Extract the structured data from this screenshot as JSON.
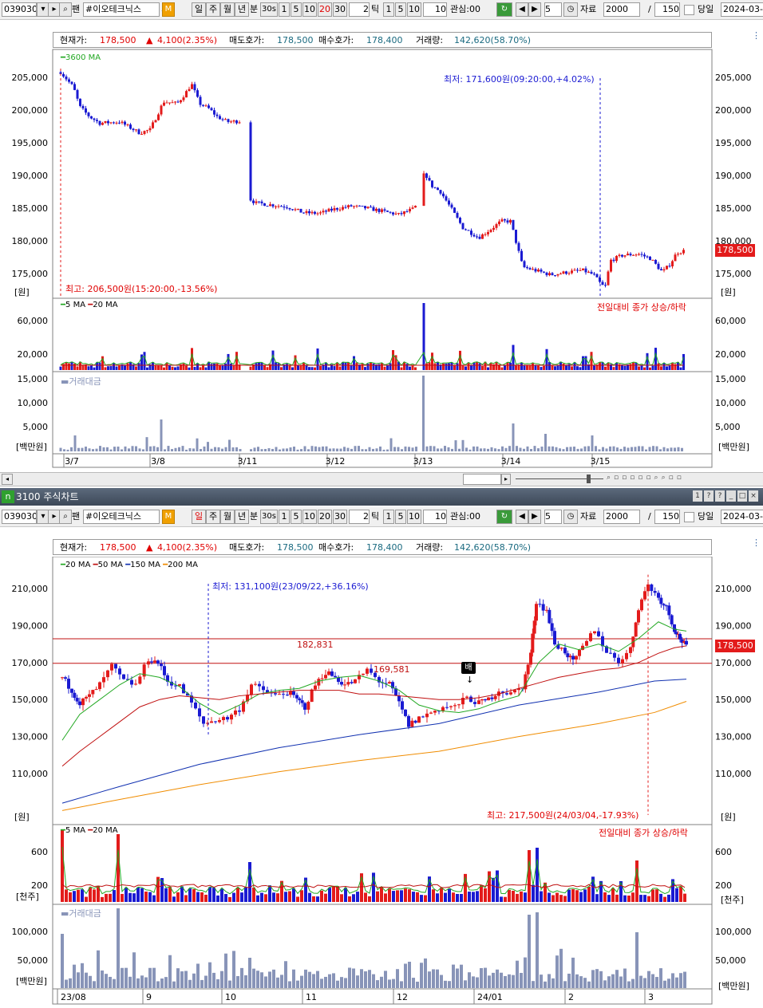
{
  "toolbar": {
    "code": "039030",
    "name": "#이오테크닉스",
    "periods": [
      "일",
      "주",
      "월",
      "년",
      "분"
    ],
    "sec": "30s",
    "mins": [
      "1",
      "5",
      "10",
      "20",
      "30"
    ],
    "tick_value": "2",
    "tick_label": "틱",
    "ticks": [
      "1",
      "5",
      "10"
    ],
    "ticks_val": "10",
    "watch": "관심:00",
    "step": "5",
    "data_label": "자료",
    "data_count": "2000",
    "slash": "/",
    "view_count": "150",
    "today_label": "당일",
    "date": "2024-03-"
  },
  "info": {
    "price_label": "현재가:",
    "price": "178,500",
    "change": "4,100(2.35%)",
    "ask_label": "매도호가:",
    "ask": "178,500",
    "bid_label": "매수호가:",
    "bid": "178,400",
    "volume_label": "거래량:",
    "volume": "142,620(58.70%)"
  },
  "window_title": "3100 주식차트",
  "window_buttons": [
    "1",
    "?",
    "?",
    "_",
    "□",
    "×"
  ],
  "colors": {
    "up": "#e31b1b",
    "down": "#1a1ad2",
    "ma_green": "#22a822",
    "ma_red": "#c01010",
    "ma_blue": "#1030b0",
    "ma_orange": "#f08c00",
    "amount": "#8894b8",
    "price_box": "#e31b1b"
  },
  "top_chart": {
    "legend": "3600 MA",
    "y_ticks": [
      "205,000",
      "200,000",
      "195,000",
      "190,000",
      "185,000",
      "180,000",
      "175,000"
    ],
    "unit_won": "[원]",
    "max_label": "최저: 171,600원(09:20:00,+4.02%)",
    "min_label": "최고: 206,500원(15:20:00,-13.56%)",
    "current_price": "178,500",
    "vol_legend_5": "5 MA",
    "vol_legend_20": "20 MA",
    "vol_note": "전일대비 종가 상승/하락",
    "vol_ticks": [
      "60,000",
      "20,000"
    ],
    "amt_legend": "거래대금",
    "amt_ticks": [
      "15,000",
      "10,000",
      "5,000"
    ],
    "amt_unit": "[백만원]",
    "dates": [
      "3/7",
      "3/8",
      "3/11",
      "3/12",
      "3/13",
      "3/14",
      "3/15"
    ]
  },
  "bottom_chart": {
    "legend": [
      "20 MA",
      "50 MA",
      "150 MA",
      "200 MA"
    ],
    "y_ticks": [
      "210,000",
      "190,000",
      "170,000",
      "150,000",
      "130,000",
      "110,000"
    ],
    "unit_won": "[원]",
    "low_label": "최저: 131,100원(23/09/22,+36.16%)",
    "high_label": "최고: 217,500원(24/03/04,-17.93%)",
    "line1_label": "182,831",
    "line2_label": "169,581",
    "badge": "배",
    "current_price": "178,500",
    "vol_legend_5": "5 MA",
    "vol_legend_20": "20 MA",
    "vol_note": "전일대비 종가 상승/하락",
    "vol_ticks": [
      "600",
      "200"
    ],
    "vol_unit": "[천주]",
    "amt_legend": "거래대금",
    "amt_ticks": [
      "100,000",
      "50,000"
    ],
    "amt_unit": "[백만원]",
    "dates": [
      "23/08",
      "9",
      "10",
      "11",
      "12",
      "24/01",
      "2",
      "3"
    ]
  }
}
